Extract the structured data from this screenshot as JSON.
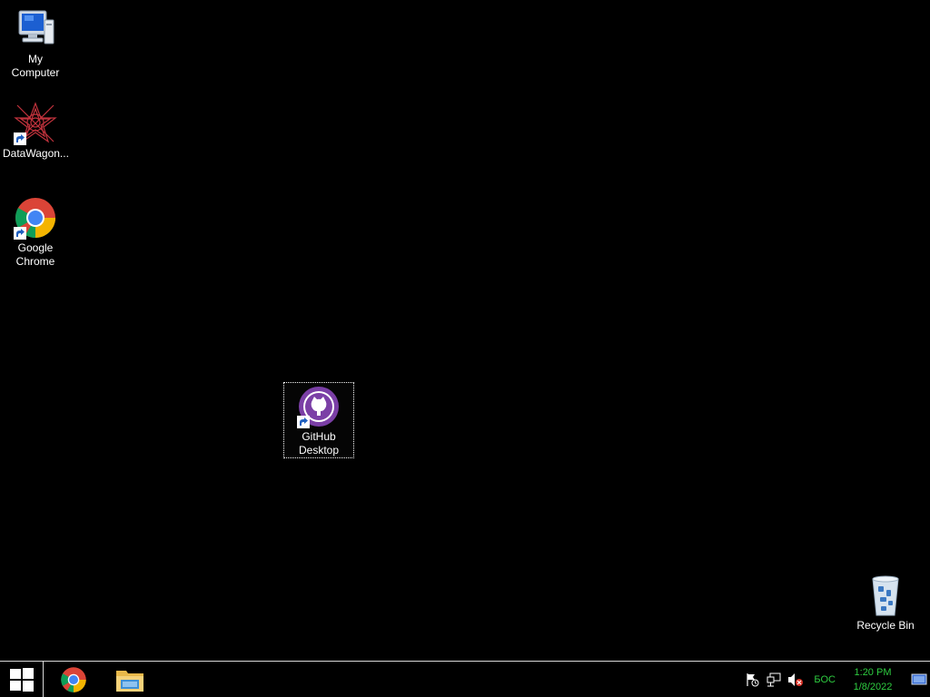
{
  "desktop": {
    "icons": [
      {
        "id": "my-computer",
        "label": "My Computer"
      },
      {
        "id": "datawagon",
        "label": "DataWagon..."
      },
      {
        "id": "google-chrome",
        "label": "Google Chrome"
      },
      {
        "id": "github-desktop",
        "label": "GitHub Desktop"
      },
      {
        "id": "recycle-bin",
        "label": "Recycle Bin"
      }
    ]
  },
  "taskbar": {
    "apps": [
      {
        "name": "chrome-icon"
      },
      {
        "name": "file-explorer-icon"
      }
    ],
    "tray": {
      "language": "БОС",
      "time": "1:20 PM",
      "date": "1/8/2022"
    }
  },
  "colors": {
    "background": "#000000",
    "tray_text": "#2ecc40",
    "github_purple": "#7b3fa6"
  }
}
